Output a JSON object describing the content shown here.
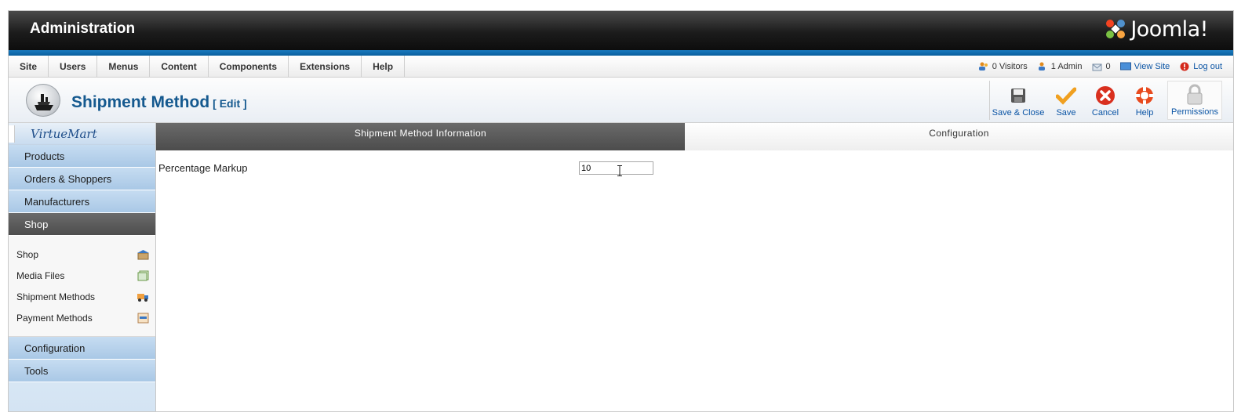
{
  "header": {
    "title": "Administration",
    "logo_text": "Joomla!"
  },
  "menu": [
    "Site",
    "Users",
    "Menus",
    "Content",
    "Components",
    "Extensions",
    "Help"
  ],
  "status": {
    "visitors": "0 Visitors",
    "admins": "1 Admin",
    "messages": "0",
    "view_site": "View Site",
    "logout": "Log out"
  },
  "page": {
    "title": "Shipment Method",
    "subtitle": "[ Edit ]"
  },
  "toolbar": {
    "save_close": "Save & Close",
    "save": "Save",
    "cancel": "Cancel",
    "help": "Help",
    "permissions": "Permissions"
  },
  "sidebar": {
    "logo": "VirtueMart",
    "categories": [
      "Products",
      "Orders & Shoppers",
      "Manufacturers",
      "Shop"
    ],
    "shop_items": [
      "Shop",
      "Media Files",
      "Shipment Methods",
      "Payment Methods"
    ],
    "categories_after": [
      "Configuration",
      "Tools"
    ]
  },
  "tabs": {
    "info": "Shipment Method Information",
    "config": "Configuration"
  },
  "form": {
    "label": "Percentage Markup",
    "value": "10"
  },
  "colors": {
    "accent_blue": "#15598f",
    "header_dark": "#1c1c1c",
    "active_gray": "#555555"
  }
}
